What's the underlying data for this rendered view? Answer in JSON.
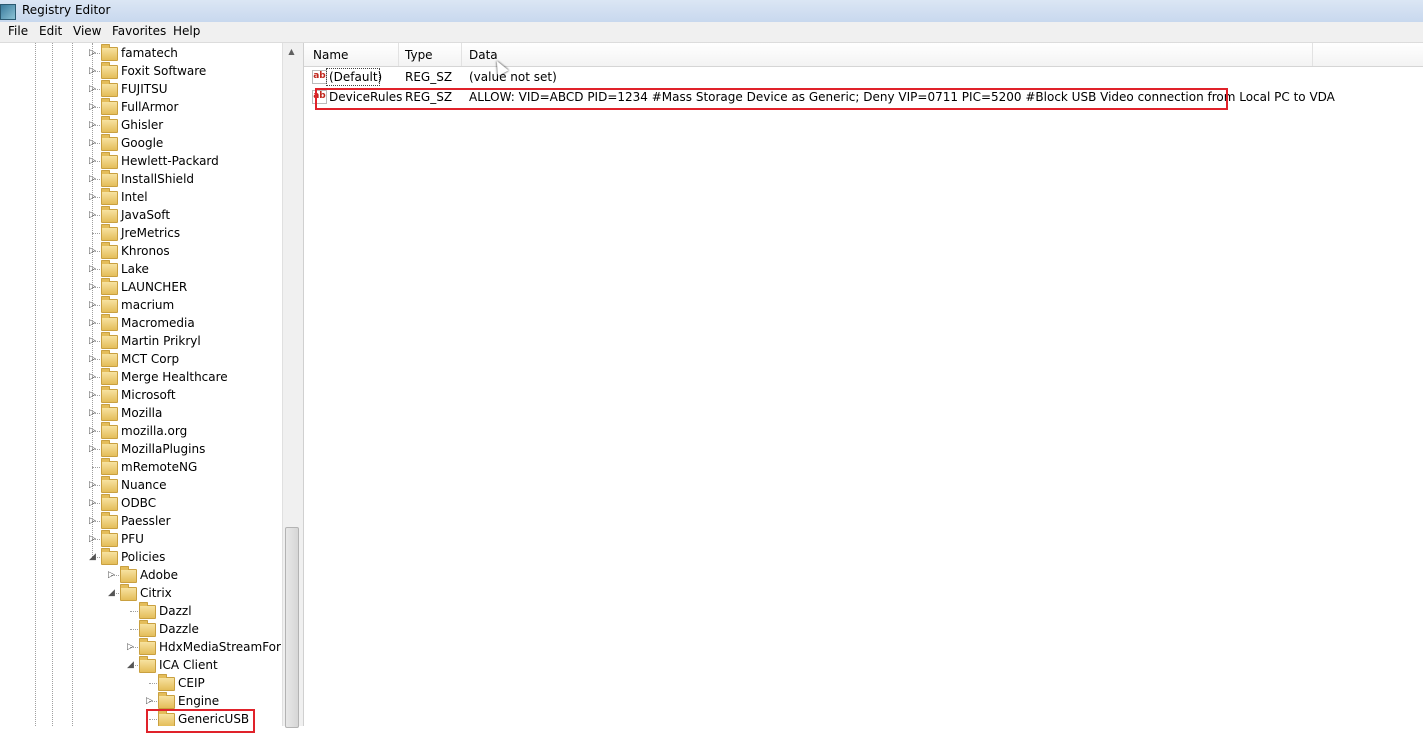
{
  "window": {
    "title": "Registry Editor"
  },
  "menu": [
    "File",
    "Edit",
    "View",
    "Favorites",
    "Help"
  ],
  "tree": {
    "items": [
      {
        "label": "famatech",
        "expander": "▷"
      },
      {
        "label": "Foxit Software",
        "expander": "▷"
      },
      {
        "label": "FUJITSU",
        "expander": "▷"
      },
      {
        "label": "FullArmor",
        "expander": "▷"
      },
      {
        "label": "Ghisler",
        "expander": "▷"
      },
      {
        "label": "Google",
        "expander": "▷"
      },
      {
        "label": "Hewlett-Packard",
        "expander": "▷"
      },
      {
        "label": "InstallShield",
        "expander": "▷"
      },
      {
        "label": "Intel",
        "expander": "▷"
      },
      {
        "label": "JavaSoft",
        "expander": "▷"
      },
      {
        "label": "JreMetrics",
        "expander": ""
      },
      {
        "label": "Khronos",
        "expander": "▷"
      },
      {
        "label": "Lake",
        "expander": "▷"
      },
      {
        "label": "LAUNCHER",
        "expander": "▷"
      },
      {
        "label": "macrium",
        "expander": "▷"
      },
      {
        "label": "Macromedia",
        "expander": "▷"
      },
      {
        "label": "Martin Prikryl",
        "expander": "▷"
      },
      {
        "label": "MCT Corp",
        "expander": "▷"
      },
      {
        "label": "Merge Healthcare",
        "expander": "▷"
      },
      {
        "label": "Microsoft",
        "expander": "▷"
      },
      {
        "label": "Mozilla",
        "expander": "▷"
      },
      {
        "label": "mozilla.org",
        "expander": "▷"
      },
      {
        "label": "MozillaPlugins",
        "expander": "▷"
      },
      {
        "label": "mRemoteNG",
        "expander": ""
      },
      {
        "label": "Nuance",
        "expander": "▷"
      },
      {
        "label": "ODBC",
        "expander": "▷"
      },
      {
        "label": "Paessler",
        "expander": "▷"
      },
      {
        "label": "PFU",
        "expander": "▷"
      },
      {
        "label": "Policies",
        "expander": "◢"
      },
      {
        "label": "Adobe",
        "expander": "▷"
      },
      {
        "label": "Citrix",
        "expander": "◢"
      },
      {
        "label": "Dazzl",
        "expander": ""
      },
      {
        "label": "Dazzle",
        "expander": ""
      },
      {
        "label": "HdxMediaStreamForFla",
        "expander": "▷"
      },
      {
        "label": "ICA Client",
        "expander": "◢"
      },
      {
        "label": "CEIP",
        "expander": ""
      },
      {
        "label": "Engine",
        "expander": "▷"
      },
      {
        "label": "GenericUSB",
        "expander": ""
      }
    ]
  },
  "list": {
    "columns": [
      "Name",
      "Type",
      "Data"
    ],
    "rows": [
      {
        "name": "(Default)",
        "type": "REG_SZ",
        "data": "(value not set)",
        "icon": "ab"
      },
      {
        "name": "DeviceRules",
        "type": "REG_SZ",
        "data": "ALLOW: VID=ABCD PID=1234 #Mass Storage Device as Generic; Deny VIP=0711 PIC=5200 #Block USB Video connection from Local PC to VDA",
        "icon": "ab"
      }
    ]
  },
  "colors": {
    "highlight": "#e0222a"
  }
}
